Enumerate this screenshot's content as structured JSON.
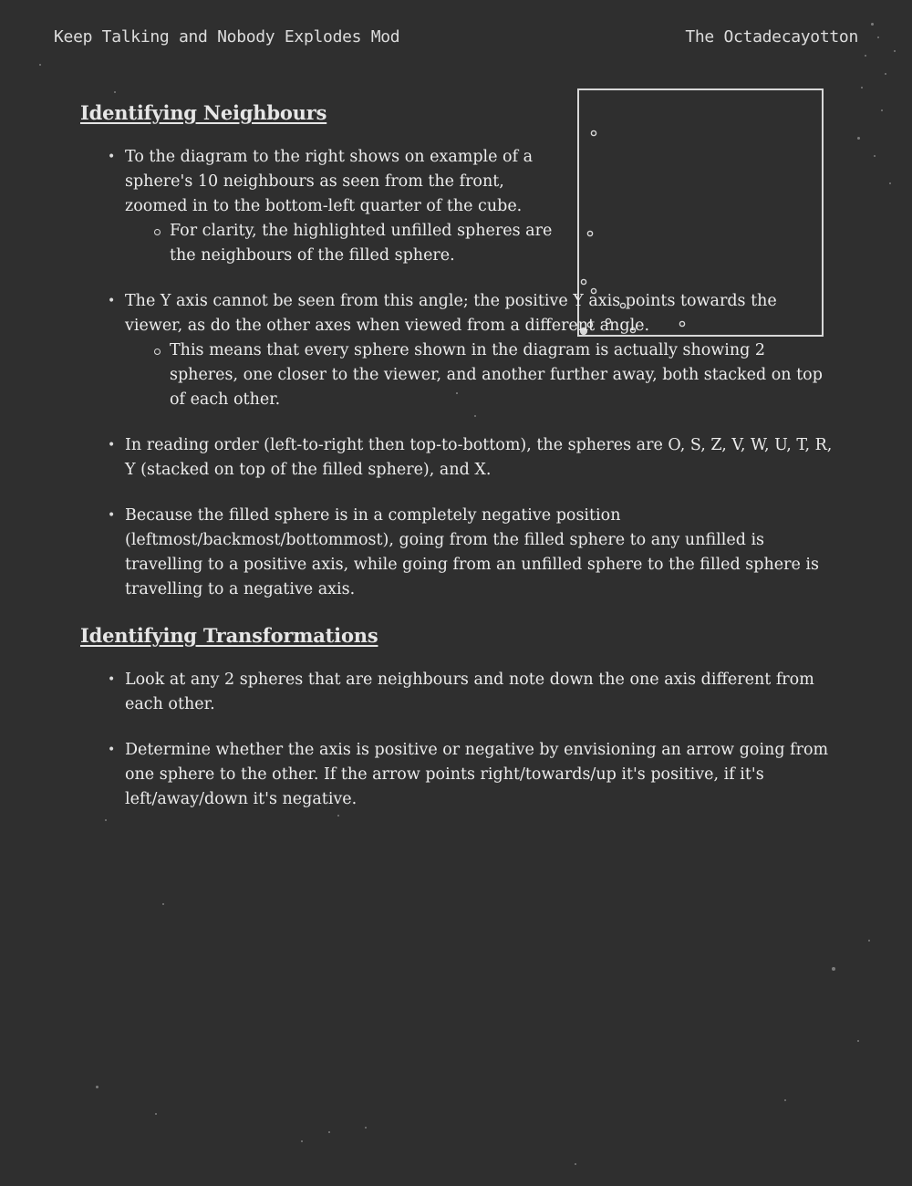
{
  "header": {
    "left": "Keep Talking and Nobody Explodes Mod",
    "right": "The Octadecayotton"
  },
  "sections": [
    {
      "title": "Identifying Neighbours",
      "bullets": [
        {
          "text": "To the diagram to the right shows on example of a sphere's 10 neighbours as seen from the front, zoomed in to the bottom-left quarter of the cube.",
          "sub": "For clarity, the highlighted unfilled spheres are the neighbours of the filled sphere."
        },
        {
          "text": "The Y axis cannot be seen from this angle; the positive Y axis points towards the viewer, as do the other axes when viewed from a different angle.",
          "sub": "This means that every sphere shown in the diagram is actually showing 2 spheres, one closer to the viewer, and another further away, both stacked on top of each other."
        },
        {
          "text": "In reading order (left-to-right then top-to-bottom), the spheres are O, S, Z, V, W, U, T, R, Y (stacked on top of the filled sphere), and X."
        },
        {
          "text": "Because the filled sphere is in a completely negative position (leftmost/backmost/bottommost), going from the filled sphere to any unfilled is travelling to a positive axis, while going from an unfilled sphere to the filled sphere is travelling to a negative axis."
        }
      ]
    },
    {
      "title": "Identifying Transformations",
      "bullets": [
        {
          "text": "Look at any 2 spheres that are neighbours and note down the one axis different from each other."
        },
        {
          "text": "Determine whether the axis is positive or negative by envisioning an arrow going from one sphere to the other. If the arrow points right/towards/up it's positive, if it's left/away/down it's negative."
        }
      ]
    }
  ],
  "diagram": {
    "spheres": [
      {
        "label": "O",
        "filled": false
      },
      {
        "label": "S",
        "filled": false
      },
      {
        "label": "Z",
        "filled": false
      },
      {
        "label": "V",
        "filled": false
      },
      {
        "label": "W",
        "filled": false
      },
      {
        "label": "U",
        "filled": false
      },
      {
        "label": "T",
        "filled": false
      },
      {
        "label": "R",
        "filled": false
      },
      {
        "label": "Y",
        "filled": false
      },
      {
        "label": "X",
        "filled": false
      },
      {
        "label": "filled",
        "filled": true
      }
    ],
    "stroke_color": "#d8d8d8"
  }
}
